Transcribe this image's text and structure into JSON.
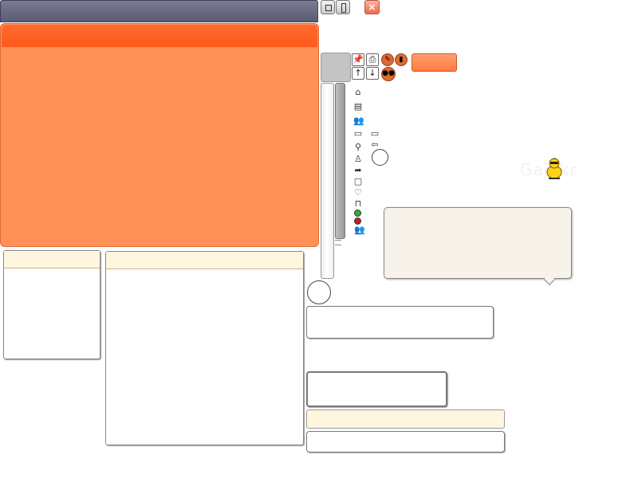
{
  "window": {
    "title": "",
    "close_glyph": "×",
    "buttons": [
      "minimize-icon",
      "maximize-icon",
      "close-icon"
    ]
  },
  "toolbar": {
    "pin_glyph": "📌",
    "print_glyph": "⎙",
    "up_glyph": "↑",
    "down_glyph": "↓",
    "orange_button_label": ""
  },
  "icons": [
    "home-icon",
    "map-icon",
    "users-icon",
    "chat-icon",
    "chat-icon",
    "back-arrow-icon",
    "search-icon",
    "user-icon",
    "forward-arrow-icon",
    "speech-icon",
    "heart-icon",
    "bookmark-icon",
    "green-status-icon",
    "red-status-icon",
    "contacts-icon"
  ],
  "glyphs": {
    "home": "⌂",
    "map": "▤",
    "users": "👥",
    "chat": "▭",
    "back": "⇦",
    "search": "⚲",
    "user": "♙",
    "forward": "➦",
    "speech": "▢",
    "heart": "♡",
    "bookmark": "⊓",
    "contacts": "👥"
  },
  "colors": {
    "accent": "#ff9158",
    "accent_dark": "#ff5a1a",
    "titlebar": "#5b5c74",
    "cream": "#fff6df",
    "status_green": "#2ab22a",
    "status_red": "#cc1a1a"
  },
  "logo": {
    "text": "Gajekr"
  }
}
